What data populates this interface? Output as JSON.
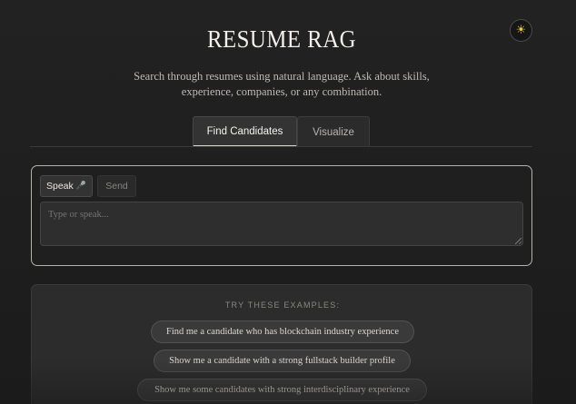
{
  "theme_toggle": {
    "icon": "sun-icon",
    "glyph": "☀"
  },
  "header": {
    "title": "RESUME RAG",
    "subtitle": "Search through resumes using natural language. Ask about skills, experience, companies, or any combination."
  },
  "tabs": [
    {
      "label": "Find Candidates",
      "active": true
    },
    {
      "label": "Visualize",
      "active": false
    }
  ],
  "chat": {
    "speak_label": "Speak",
    "mic_glyph": "🎤",
    "send_label": "Send",
    "input_placeholder": "Type or speak...",
    "input_value": ""
  },
  "examples": {
    "heading": "TRY THESE EXAMPLES:",
    "items": [
      "Find me a candidate who has blockchain industry experience",
      "Show me a candidate with a strong fullstack builder profile",
      "Show me some candidates with strong interdisciplinary experience"
    ]
  }
}
